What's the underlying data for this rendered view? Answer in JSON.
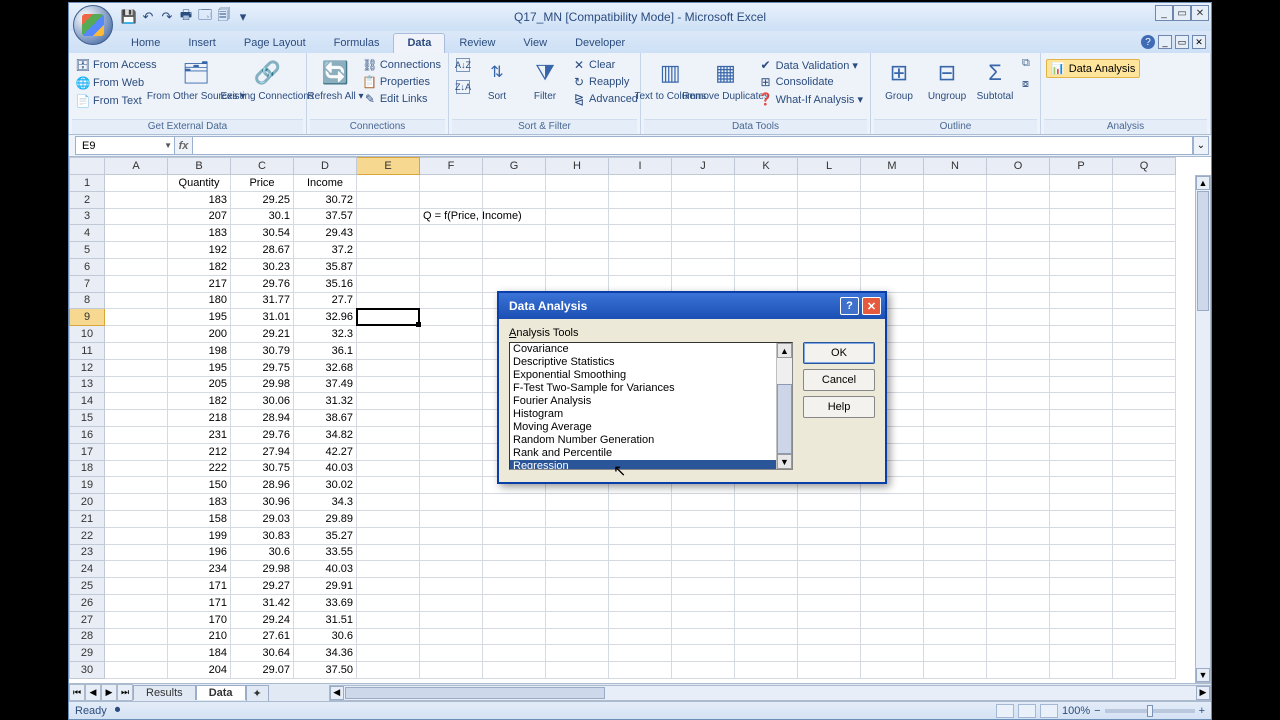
{
  "window": {
    "title": "Q17_MN  [Compatibility Mode] - Microsoft Excel"
  },
  "qat": {
    "save": "💾",
    "undo": "↶",
    "redo": "↷",
    "print": "🖶",
    "p2": "🗔",
    "p3": "🗐"
  },
  "tabs": [
    "Home",
    "Insert",
    "Page Layout",
    "Formulas",
    "Data",
    "Review",
    "View",
    "Developer"
  ],
  "active_tab": "Data",
  "ribbon": {
    "get_external": {
      "from_access": "From Access",
      "from_web": "From Web",
      "from_text": "From Text",
      "other": "From Other Sources ▾",
      "existing": "Existing Connections",
      "label": "Get External Data"
    },
    "connections": {
      "refresh": "Refresh All ▾",
      "connections": "Connections",
      "properties": "Properties",
      "edit_links": "Edit Links",
      "label": "Connections"
    },
    "sort_filter": {
      "sort": "Sort",
      "filter": "Filter",
      "clear": "Clear",
      "reapply": "Reapply",
      "advanced": "Advanced",
      "label": "Sort & Filter"
    },
    "data_tools": {
      "t2c": "Text to Columns",
      "dup": "Remove Duplicates",
      "val": "Data Validation ▾",
      "cons": "Consolidate",
      "what": "What-If Analysis ▾",
      "label": "Data Tools"
    },
    "outline": {
      "group": "Group",
      "ungroup": "Ungroup",
      "subtotal": "Subtotal",
      "label": "Outline"
    },
    "analysis": {
      "btn": "Data Analysis",
      "label": "Analysis"
    }
  },
  "namebox": "E9",
  "formula_value": "",
  "columns": [
    "A",
    "B",
    "C",
    "D",
    "E",
    "F",
    "G",
    "H",
    "I",
    "J",
    "K",
    "L",
    "M",
    "N",
    "O",
    "P",
    "Q"
  ],
  "row_count": 30,
  "selected_col": "E",
  "selected_row": 9,
  "headers": {
    "B": "Quantity",
    "C": "Price",
    "D": "Income"
  },
  "annotation_cell": {
    "row": 3,
    "col": "F",
    "text": "Q = f(Price, Income)"
  },
  "data_rows": [
    {
      "B": "183",
      "C": "29.25",
      "D": "30.72"
    },
    {
      "B": "207",
      "C": "30.1",
      "D": "37.57"
    },
    {
      "B": "183",
      "C": "30.54",
      "D": "29.43"
    },
    {
      "B": "192",
      "C": "28.67",
      "D": "37.2"
    },
    {
      "B": "182",
      "C": "30.23",
      "D": "35.87"
    },
    {
      "B": "217",
      "C": "29.76",
      "D": "35.16"
    },
    {
      "B": "180",
      "C": "31.77",
      "D": "27.7"
    },
    {
      "B": "195",
      "C": "31.01",
      "D": "32.96"
    },
    {
      "B": "200",
      "C": "29.21",
      "D": "32.3"
    },
    {
      "B": "198",
      "C": "30.79",
      "D": "36.1"
    },
    {
      "B": "195",
      "C": "29.75",
      "D": "32.68"
    },
    {
      "B": "205",
      "C": "29.98",
      "D": "37.49"
    },
    {
      "B": "182",
      "C": "30.06",
      "D": "31.32"
    },
    {
      "B": "218",
      "C": "28.94",
      "D": "38.67"
    },
    {
      "B": "231",
      "C": "29.76",
      "D": "34.82"
    },
    {
      "B": "212",
      "C": "27.94",
      "D": "42.27"
    },
    {
      "B": "222",
      "C": "30.75",
      "D": "40.03"
    },
    {
      "B": "150",
      "C": "28.96",
      "D": "30.02"
    },
    {
      "B": "183",
      "C": "30.96",
      "D": "34.3"
    },
    {
      "B": "158",
      "C": "29.03",
      "D": "29.89"
    },
    {
      "B": "199",
      "C": "30.83",
      "D": "35.27"
    },
    {
      "B": "196",
      "C": "30.6",
      "D": "33.55"
    },
    {
      "B": "234",
      "C": "29.98",
      "D": "40.03"
    },
    {
      "B": "171",
      "C": "29.27",
      "D": "29.91"
    },
    {
      "B": "171",
      "C": "31.42",
      "D": "33.69"
    },
    {
      "B": "170",
      "C": "29.24",
      "D": "31.51"
    },
    {
      "B": "210",
      "C": "27.61",
      "D": "30.6"
    },
    {
      "B": "184",
      "C": "30.64",
      "D": "34.36"
    },
    {
      "B": "204",
      "C": "29.07",
      "D": "37.50"
    }
  ],
  "sheets": [
    "Results",
    "Data"
  ],
  "active_sheet": "Data",
  "dialog": {
    "title": "Data Analysis",
    "label": "Analysis Tools",
    "items": [
      "Covariance",
      "Descriptive Statistics",
      "Exponential Smoothing",
      "F-Test Two-Sample for Variances",
      "Fourier Analysis",
      "Histogram",
      "Moving Average",
      "Random Number Generation",
      "Rank and Percentile",
      "Regression"
    ],
    "selected": "Regression",
    "ok": "OK",
    "cancel": "Cancel",
    "help": "Help"
  },
  "status": {
    "ready": "Ready",
    "zoom": "100%"
  }
}
